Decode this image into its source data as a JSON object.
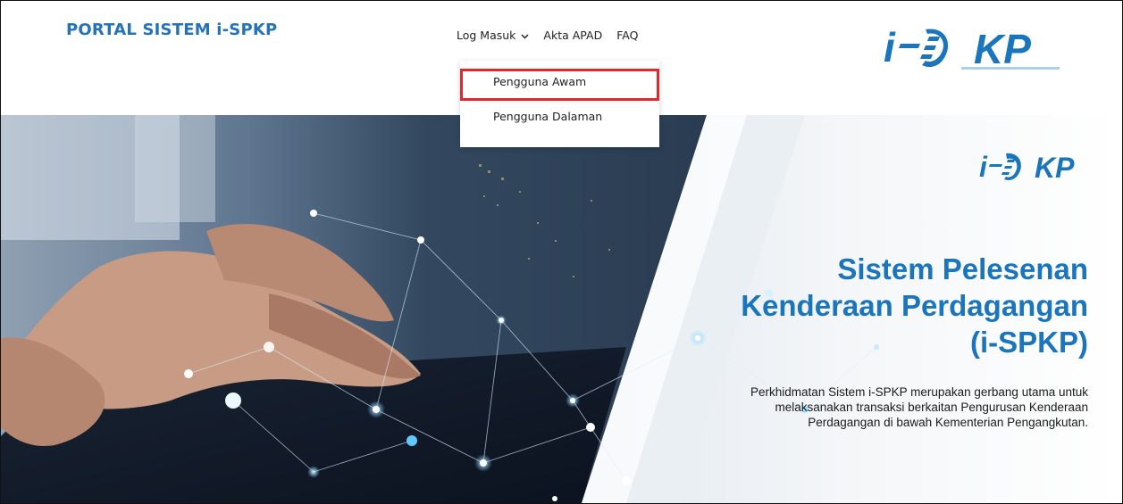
{
  "site": {
    "title": "PORTAL SISTEM i-SPKP"
  },
  "nav": {
    "items": [
      {
        "label": "Log Masuk",
        "icon": "chevron-down-icon"
      },
      {
        "label": "Akta APAD"
      },
      {
        "label": "FAQ"
      }
    ],
    "dropdown": [
      "Pengguna Awam",
      "Pengguna Dalaman"
    ]
  },
  "logo": {
    "text": "i-SPKP"
  },
  "hero": {
    "title_lines": [
      "Sistem Pelesenan",
      "Kenderaan Perdagangan",
      "(i-SPKP)"
    ],
    "description": "Perkhidmatan Sistem i-SPKP merupakan gerbang utama untuk melaksanakan transaksi berkaitan Pengurusan Kenderaan Perdagangan di bawah Kementerian Pengangkutan."
  },
  "colors": {
    "brand_blue": "#1b75bc",
    "highlight_red": "#e0282d",
    "title_blue": "#2473b9"
  }
}
